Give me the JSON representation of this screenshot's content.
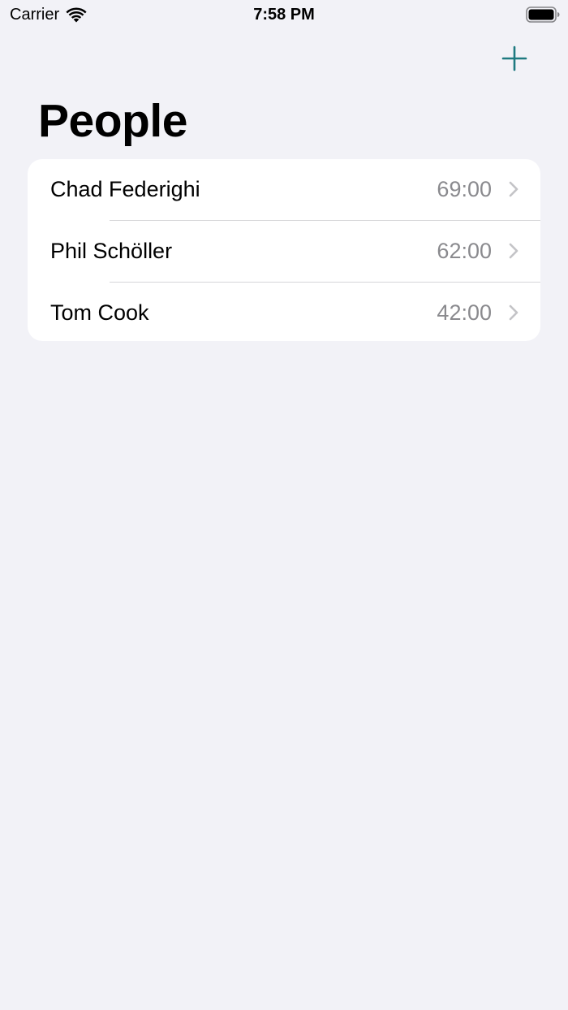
{
  "status_bar": {
    "carrier": "Carrier",
    "time": "7:58 PM"
  },
  "nav": {
    "add_icon": "plus-icon",
    "title": "People"
  },
  "colors": {
    "accent": "#1f7a80",
    "background": "#f2f2f7",
    "secondary_text": "#8a8a8e"
  },
  "people": [
    {
      "name": "Chad Federighi",
      "value": "69:00"
    },
    {
      "name": "Phil Schöller",
      "value": "62:00"
    },
    {
      "name": "Tom Cook",
      "value": "42:00"
    }
  ]
}
